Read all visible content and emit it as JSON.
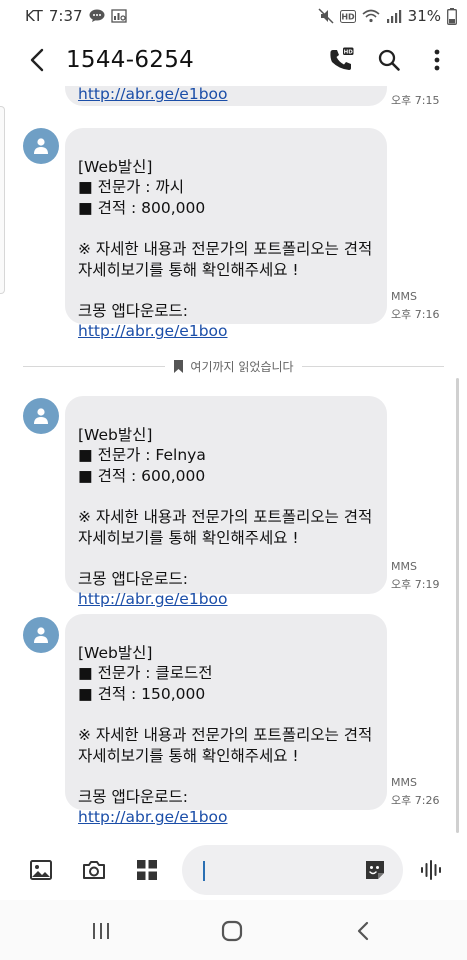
{
  "status_bar": {
    "carrier": "KT",
    "time": "7:37",
    "battery": "31%"
  },
  "header": {
    "title": "1544-6254"
  },
  "conversation": {
    "top_partial": {
      "link": "http://abr.ge/e1boo",
      "time": "오후 7:15"
    },
    "messages": [
      {
        "text": "[Web발신]\n■ 전문가 : 까시\n■ 견적 : 800,000\n\n※ 자세한 내용과 전문가의 포트폴리오는 견적 자세히보기를 통해 확인해주세요 !\n\n크몽 앱다운로드:",
        "link": "http://abr.ge/e1boo",
        "type": "MMS",
        "time": "오후 7:16"
      },
      {
        "text": "[Web발신]\n■ 전문가 : Felnya\n■ 견적 : 600,000\n\n※ 자세한 내용과 전문가의 포트폴리오는 견적 자세히보기를 통해 확인해주세요 !\n\n크몽 앱다운로드:",
        "link": "http://abr.ge/e1boo",
        "type": "MMS",
        "time": "오후 7:19"
      },
      {
        "text": "[Web발신]\n■ 전문가 : 클로드전\n■ 견적 : 150,000\n\n※ 자세한 내용과 전문가의 포트폴리오는 견적 자세히보기를 통해 확인해주세요 !\n\n크몽 앱다운로드:",
        "link": "http://abr.ge/e1boo",
        "type": "MMS",
        "time": "오후 7:26"
      }
    ],
    "divider_label": "여기까지 읽었습니다"
  },
  "composer": {
    "value": "",
    "placeholder": ""
  },
  "icons": {
    "back": "arrow-left-icon",
    "call": "phone-hd-icon",
    "search": "search-icon",
    "more": "more-vertical-icon",
    "gallery": "image-icon",
    "camera": "camera-icon",
    "apps": "grid-icon",
    "sticker": "sticker-icon",
    "voice": "voice-wave-icon"
  },
  "colors": {
    "avatar": "#6f9fc5",
    "bubble": "#ececee",
    "link": "#1b4ea8"
  }
}
